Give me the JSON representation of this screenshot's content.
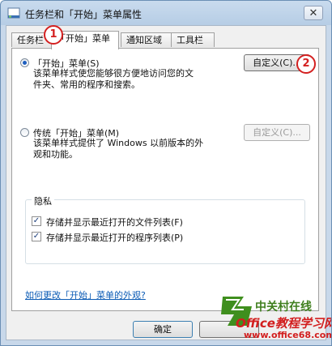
{
  "window": {
    "title": "任务栏和「开始」菜单属性",
    "close_label": "✕"
  },
  "tabs": [
    {
      "label": "任务栏",
      "active": false
    },
    {
      "label": "「开始」菜单",
      "active": true
    },
    {
      "label": "通知区域",
      "active": false
    },
    {
      "label": "工具栏",
      "active": false
    }
  ],
  "callouts": {
    "one": "1",
    "two": "2"
  },
  "start_menu": {
    "option_label": "「开始」菜单(S)",
    "option_desc_line1": "该菜单样式使您能够很方便地访问您的文",
    "option_desc_line2": "件夹、常用的程序和搜索。",
    "customize_label": "自定义(C)...",
    "selected": true
  },
  "classic_menu": {
    "option_label": "传统「开始」菜单(M)",
    "option_desc_line1": "该菜单样式提供了 Windows 以前版本的外",
    "option_desc_line2": "观和功能。",
    "customize_label": "自定义(C)...",
    "selected": false
  },
  "privacy": {
    "title": "隐私",
    "items": [
      {
        "label": "存储并显示最近打开的文件列表(F)",
        "checked": true
      },
      {
        "label": "存储并显示最近打开的程序列表(P)",
        "checked": true
      }
    ]
  },
  "help_link": "如何更改「开始」菜单的外观?",
  "footer": {
    "ok_label": "确定"
  },
  "watermark": {
    "top": "中关村在线",
    "middle": "Office教程学习网",
    "bottom": "www.office68.com"
  }
}
